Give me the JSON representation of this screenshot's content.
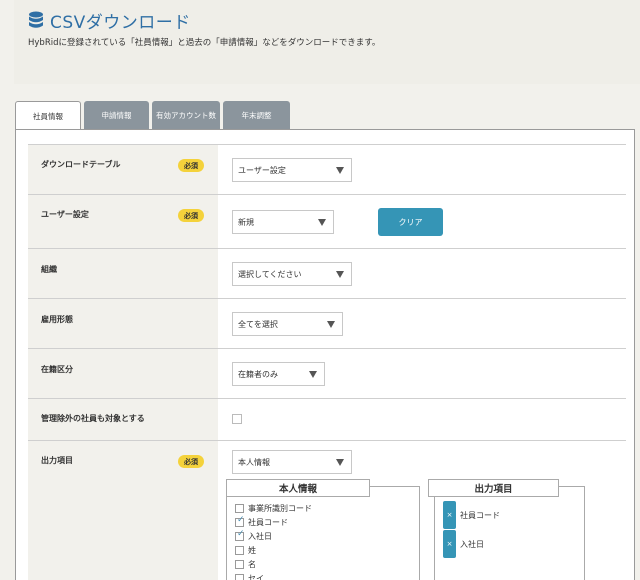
{
  "header": {
    "title": "CSVダウンロード",
    "subtitle": "HybRidに登録されている「社員情報」と過去の「申請情報」などをダウンロードできます。"
  },
  "tabs": [
    {
      "label": "社員情報",
      "active": true
    },
    {
      "label": "申請情報",
      "active": false
    },
    {
      "label": "有効アカウント数",
      "active": false
    },
    {
      "label": "年末調整",
      "active": false
    }
  ],
  "form": {
    "required_label": "必須",
    "download_table": {
      "label": "ダウンロードテーブル",
      "value": "ユーザー設定"
    },
    "user_setting": {
      "label": "ユーザー設定",
      "value": "新規",
      "clear_button": "クリア"
    },
    "organization": {
      "label": "組織",
      "value": "選択してください"
    },
    "employment_type": {
      "label": "雇用形態",
      "value": "全てを選択"
    },
    "enrollment": {
      "label": "在籍区分",
      "value": "在籍者のみ"
    },
    "include_excluded": {
      "label": "管理除外の社員も対象とする",
      "checked": false
    },
    "output_items": {
      "label": "出力項目",
      "value": "本人情報",
      "source_title": "本人情報",
      "source_items": [
        {
          "label": "事業所識別コード",
          "checked": false
        },
        {
          "label": "社員コード",
          "checked": true
        },
        {
          "label": "入社日",
          "checked": true
        },
        {
          "label": "姓",
          "checked": false
        },
        {
          "label": "名",
          "checked": false
        },
        {
          "label": "セイ",
          "checked": false
        }
      ],
      "target_title": "出力項目",
      "target_items": [
        {
          "label": "社員コード",
          "remove": "×"
        },
        {
          "label": "入社日",
          "remove": "×"
        }
      ]
    }
  },
  "colors": {
    "accent": "#3595b6",
    "title": "#2f6fa5",
    "badge": "#f4d23b",
    "tab_inactive": "#8b959d"
  }
}
